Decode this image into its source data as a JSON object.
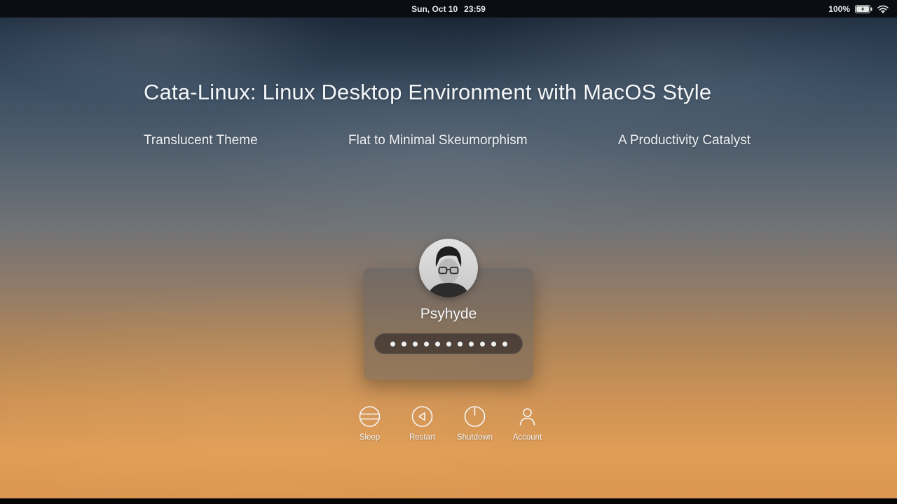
{
  "menu_bar": {
    "date": "Sun, Oct 10",
    "time": "23:59",
    "battery_percent": "100%"
  },
  "hero": {
    "title": "Cata-Linux: Linux Desktop Environment with MacOS Style",
    "features": [
      {
        "label": "Translucent Theme"
      },
      {
        "label": "Flat to Minimal Skeumorphism"
      },
      {
        "label": "A Productivity Catalyst"
      }
    ]
  },
  "login": {
    "username": "Psyhyde",
    "password_dots": 11
  },
  "actions": [
    {
      "id": "sleep",
      "label": "Sleep"
    },
    {
      "id": "restart",
      "label": "Restart"
    },
    {
      "id": "shutdown",
      "label": "Shutdown"
    },
    {
      "id": "account",
      "label": "Account"
    }
  ],
  "colors": {
    "menubar_bg": "#0a0d12",
    "sky_top": "#1e2a3a",
    "sunset_bottom": "#da9650",
    "card_bg": "rgba(86,88,92,0.42)",
    "text": "#f2f5f7"
  }
}
